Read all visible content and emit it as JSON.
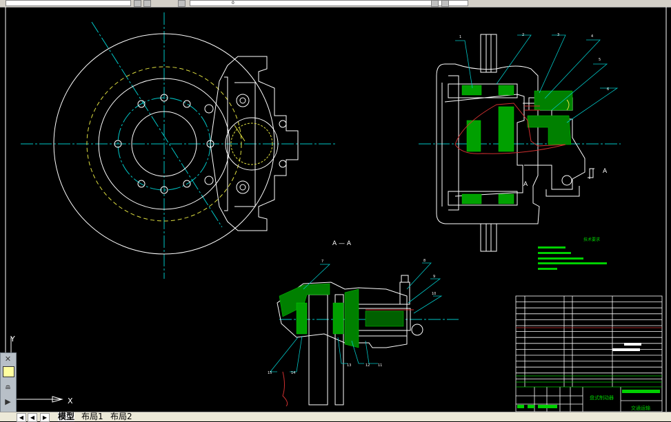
{
  "toolbar": {
    "layer_value": "",
    "layer_name": "0"
  },
  "tabs": [
    {
      "label": "模型",
      "active": true
    },
    {
      "label": "布局1",
      "active": false
    },
    {
      "label": "布局2",
      "active": false
    }
  ],
  "ucs": {
    "x_label": "X",
    "y_label": "Y"
  },
  "drawing": {
    "section_label": "A — A",
    "view_marker": "A",
    "part_numbers_top": [
      "1",
      "2",
      "3",
      "4",
      "5",
      "6"
    ],
    "part_numbers_bottom": [
      "7",
      "8",
      "9",
      "10",
      "11",
      "12",
      "13",
      "14",
      "15"
    ],
    "notes_heading": "技术要求",
    "title_block": {
      "drawing_name": "盘式制动器",
      "school": "交通运输"
    }
  },
  "colors": {
    "background": "#000000",
    "outline": "#ffffff",
    "centerline": "#00c8c8",
    "hatch": "#00d000",
    "hidden": "#e0e040",
    "break_line": "#d03030"
  }
}
